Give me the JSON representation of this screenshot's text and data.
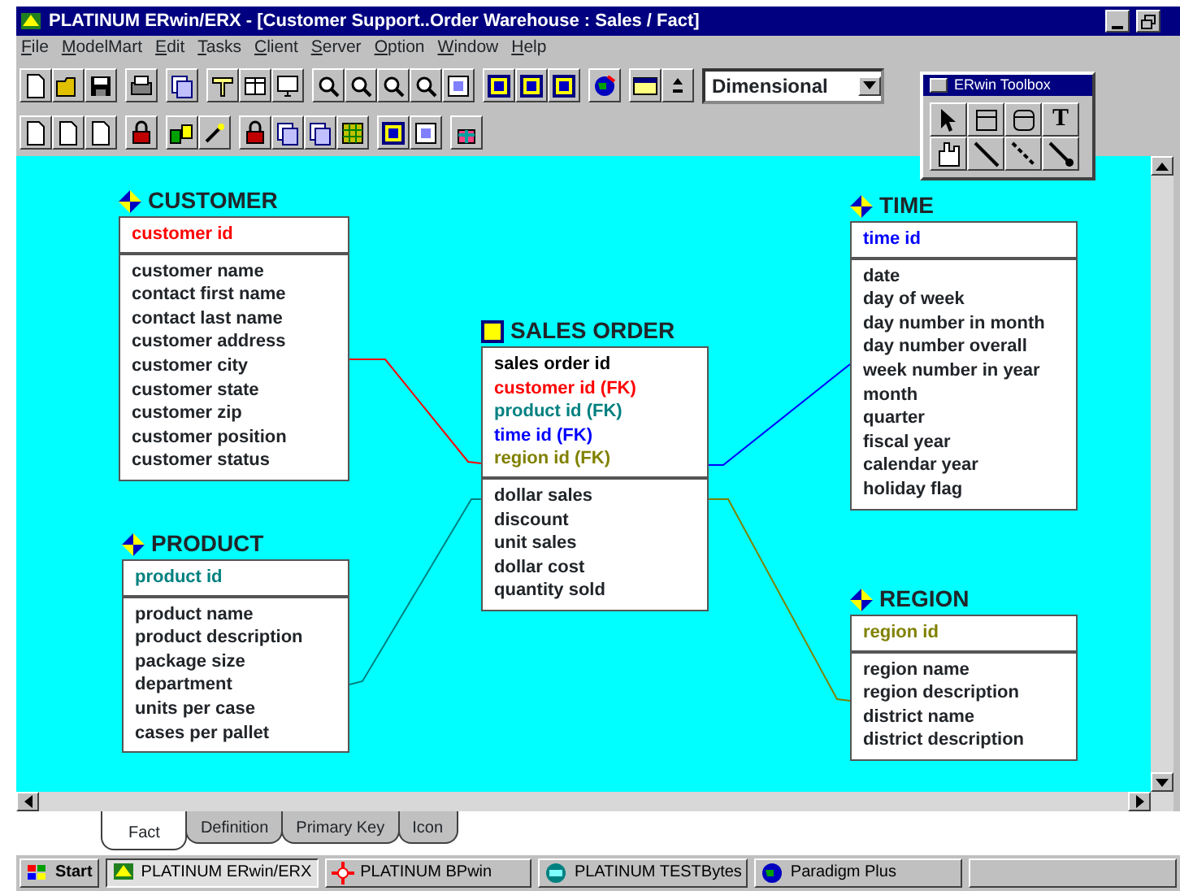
{
  "window": {
    "title": "PLATINUM ERwin/ERX - [Customer Support..Order Warehouse : Sales / Fact]"
  },
  "menu": [
    "File",
    "ModelMart",
    "Edit",
    "Tasks",
    "Client",
    "Server",
    "Option",
    "Window",
    "Help"
  ],
  "toolbar": {
    "view_select": "Dimensional"
  },
  "toolbox": {
    "title": "ERwin Toolbox",
    "text_tool": "T"
  },
  "entities": [
    {
      "name": "CUSTOMER",
      "kind": "dimension",
      "keys": [
        {
          "name": "customer id",
          "color": "#ff0000"
        }
      ],
      "attributes": [
        "customer name",
        "contact first name",
        "contact last name",
        "customer address",
        "customer city",
        "customer state",
        "customer zip",
        "customer position",
        "customer status"
      ]
    },
    {
      "name": "SALES ORDER",
      "kind": "fact",
      "keys": [
        {
          "name": "sales order id",
          "color": "#000000"
        },
        {
          "name": "customer id (FK)",
          "color": "#ff0000"
        },
        {
          "name": "product id (FK)",
          "color": "#008080"
        },
        {
          "name": "time id (FK)",
          "color": "#0000ff"
        },
        {
          "name": "region id (FK)",
          "color": "#808000"
        }
      ],
      "attributes": [
        "dollar sales",
        "discount",
        "unit sales",
        "dollar cost",
        "quantity sold"
      ]
    },
    {
      "name": "TIME",
      "kind": "dimension",
      "keys": [
        {
          "name": "time id",
          "color": "#0000ff"
        }
      ],
      "attributes": [
        "date",
        "day of week",
        "day number in month",
        "day number overall",
        "week number in year",
        "month",
        "quarter",
        "fiscal year",
        "calendar year",
        "holiday flag"
      ]
    },
    {
      "name": "PRODUCT",
      "kind": "dimension",
      "keys": [
        {
          "name": "product id",
          "color": "#008080"
        }
      ],
      "attributes": [
        "product name",
        "product description",
        "package size",
        "department",
        "units per case",
        "cases per pallet"
      ]
    },
    {
      "name": "REGION",
      "kind": "dimension",
      "keys": [
        {
          "name": "region id",
          "color": "#808000"
        }
      ],
      "attributes": [
        "region name",
        "region description",
        "district name",
        "district description"
      ]
    }
  ],
  "tabs": [
    {
      "label": "Fact",
      "selected": true
    },
    {
      "label": "Definition",
      "selected": false
    },
    {
      "label": "Primary Key",
      "selected": false
    },
    {
      "label": "Icon",
      "selected": false
    }
  ],
  "taskbar": {
    "start": "Start",
    "tasks": [
      {
        "label": "PLATINUM ERwin/ERX",
        "selected": true
      },
      {
        "label": "PLATINUM BPwin",
        "selected": false
      },
      {
        "label": "PLATINUM TESTBytes",
        "selected": false
      },
      {
        "label": "Paradigm Plus",
        "selected": false
      }
    ]
  }
}
